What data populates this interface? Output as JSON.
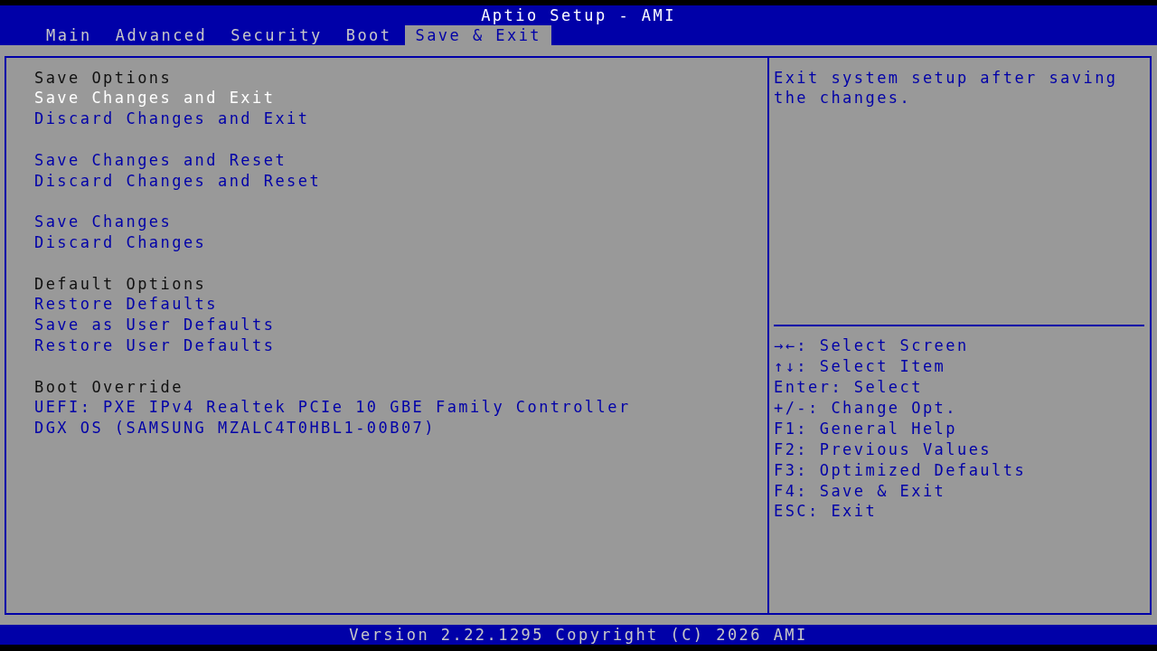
{
  "window": {
    "title": "Aptio Setup - AMI"
  },
  "tabs": [
    {
      "label": "Main",
      "selected": false
    },
    {
      "label": "Advanced",
      "selected": false
    },
    {
      "label": "Security",
      "selected": false
    },
    {
      "label": "Boot",
      "selected": false
    },
    {
      "label": "Save & Exit",
      "selected": true
    }
  ],
  "options": {
    "groups": [
      {
        "heading": "Save Options",
        "items": [
          {
            "label": "Save Changes and Exit",
            "selected": true
          },
          {
            "label": "Discard Changes and Exit",
            "selected": false
          }
        ]
      },
      {
        "items": [
          {
            "label": "Save Changes and Reset",
            "selected": false
          },
          {
            "label": "Discard Changes and Reset",
            "selected": false
          }
        ]
      },
      {
        "items": [
          {
            "label": "Save Changes",
            "selected": false
          },
          {
            "label": "Discard Changes",
            "selected": false
          }
        ]
      },
      {
        "heading": "Default Options",
        "items": [
          {
            "label": "Restore Defaults",
            "selected": false
          },
          {
            "label": "Save as User Defaults",
            "selected": false
          },
          {
            "label": "Restore User Defaults",
            "selected": false
          }
        ]
      },
      {
        "heading": "Boot Override",
        "items": [
          {
            "label": "UEFI: PXE IPv4 Realtek PCIe 10 GBE Family Controller",
            "selected": false
          },
          {
            "label": "DGX OS (SAMSUNG MZALC4T0HBL1-00B07)",
            "selected": false
          }
        ]
      }
    ]
  },
  "help": {
    "text": "Exit system setup after saving the changes.",
    "keys": [
      "→←: Select Screen",
      "↑↓: Select Item",
      "Enter: Select",
      "+/-: Change Opt.",
      "F1: General Help",
      "F2: Previous Values",
      "F3: Optimized Defaults",
      "F4: Save & Exit",
      "ESC: Exit"
    ]
  },
  "status_bar": {
    "text": "Version 2.22.1295 Copyright (C) 2026 AMI"
  }
}
